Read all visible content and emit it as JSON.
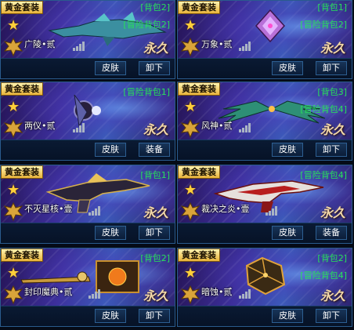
{
  "cards": [
    {
      "badge": "黄金套装",
      "bag_top": "[背包2]",
      "bag_mid": "[冒险背包2]",
      "name": "广陵•贰",
      "permanent": "永久",
      "btn_left": "皮肤",
      "btn_right": "卸下",
      "weapon_icon": "dragon-rifle-icon"
    },
    {
      "badge": "黄金套装",
      "bag_top": "[背包1]",
      "bag_mid": "[冒险背包2]",
      "name": "万象•贰",
      "permanent": "永久",
      "btn_left": "皮肤",
      "btn_right": "卸下",
      "weapon_icon": "crystal-orb-icon"
    },
    {
      "badge": "黄金套装",
      "bag_top": "",
      "bag_mid": "[冒险背包1]",
      "name": "两仪•贰",
      "permanent": "永久",
      "btn_left": "皮肤",
      "btn_right": "装备",
      "weapon_icon": "dual-blade-icon"
    },
    {
      "badge": "黄金套装",
      "bag_top": "[背包3]",
      "bag_mid": "[冒险背包4]",
      "name": "风神•贰",
      "permanent": "永久",
      "btn_left": "皮肤",
      "btn_right": "卸下",
      "weapon_icon": "wing-bow-icon"
    },
    {
      "badge": "黄金套装",
      "bag_top": "[背包1]",
      "bag_mid": "",
      "name": "不灭星核•壹",
      "permanent": "永久",
      "btn_left": "皮肤",
      "btn_right": "卸下",
      "weapon_icon": "star-core-rifle-icon"
    },
    {
      "badge": "黄金套装",
      "bag_top": "",
      "bag_mid": "[冒险背包4]",
      "name": "裁决之炎•壹",
      "permanent": "永久",
      "btn_left": "皮肤",
      "btn_right": "装备",
      "weapon_icon": "flame-rifle-icon"
    },
    {
      "badge": "黄金套装",
      "bag_top": "[背包2]",
      "bag_mid": "",
      "name": "封印魔典•贰",
      "permanent": "永久",
      "btn_left": "皮肤",
      "btn_right": "卸下",
      "weapon_icon": "seal-tome-icon"
    },
    {
      "badge": "黄金套装",
      "bag_top": "[背包2]",
      "bag_mid": "[冒险背包4]",
      "name": "暗蚀•贰",
      "permanent": "永久",
      "btn_left": "皮肤",
      "btn_right": "卸下",
      "weapon_icon": "dark-dice-icon"
    }
  ],
  "colors": {
    "badge_gold": "#e9b43a",
    "bag_green": "#27e05a",
    "panel_blue": "#3c58b9",
    "button_bg": "#173458"
  }
}
